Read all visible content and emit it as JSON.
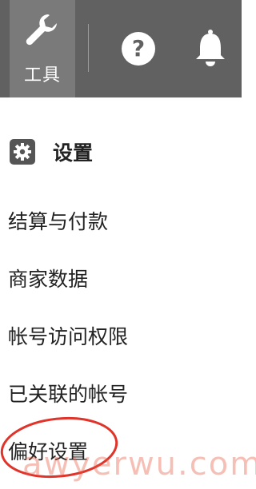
{
  "topbar": {
    "tools_label": "工具",
    "tools_icon": "wrench-icon",
    "help_icon": "question-circle-icon",
    "notifications_icon": "bell-icon",
    "bg_color": "#616161",
    "active_tab_color": "#7a7a7a"
  },
  "settings": {
    "icon": "gear-icon",
    "title": "设置"
  },
  "menu": {
    "items": [
      {
        "label": "结算与付款"
      },
      {
        "label": "商家数据"
      },
      {
        "label": "帐号访问权限"
      },
      {
        "label": "已关联的帐号"
      },
      {
        "label": "偏好设置"
      }
    ]
  },
  "annotation": {
    "highlight_color": "#e0332a"
  },
  "watermark": {
    "text": "awyerwu.com"
  }
}
